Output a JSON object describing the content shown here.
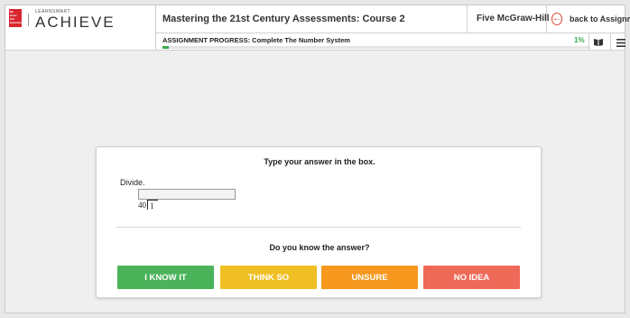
{
  "brand": {
    "logo_text": "Mc Graw Hill Education",
    "small": "LEARNSMART",
    "big": "ACHIEVE"
  },
  "header": {
    "course_title": "Mastering the 21st Century Assessments: Course 2",
    "user_name": "Five McGraw-Hill",
    "back_label": "back to Assignments",
    "back_icon": "arrow-left-icon"
  },
  "progress": {
    "label": "ASSIGNMENT PROGRESS: Complete The Number System",
    "percent_text": "1%",
    "value": 0.01,
    "color": "#3aaa4a"
  },
  "question": {
    "instruction": "Type your answer in the box.",
    "prompt": "Divide.",
    "answer_value": "",
    "divisor": "40",
    "dividend": "1"
  },
  "confidence": {
    "question": "Do you know the answer?",
    "buttons": [
      {
        "label": "I KNOW IT",
        "color": "#4bb35a"
      },
      {
        "label": "THINK SO",
        "color": "#f0bf23"
      },
      {
        "label": "UNSURE",
        "color": "#f6981e"
      },
      {
        "label": "NO IDEA",
        "color": "#ef6958"
      }
    ]
  }
}
